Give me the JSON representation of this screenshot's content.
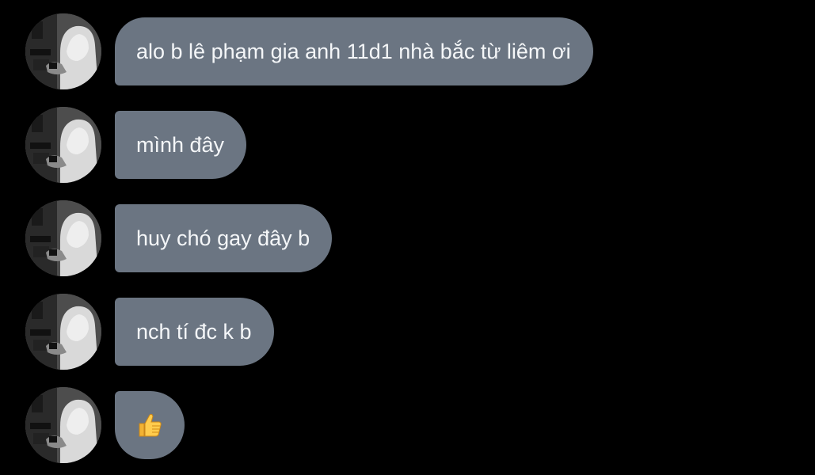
{
  "conversation": {
    "messages": [
      {
        "text": "alo b lê phạm gia anh 11d1 nhà bắc từ liêm ơi"
      },
      {
        "text": "mình đây"
      },
      {
        "text": "huy chó gay đây b"
      },
      {
        "text": "nch tí đc k b"
      },
      {
        "icon": "thumbs-up-icon"
      }
    ]
  },
  "colors": {
    "background": "#000000",
    "bubble": "#6b7582",
    "bubble_text": "#f4f6f8"
  }
}
